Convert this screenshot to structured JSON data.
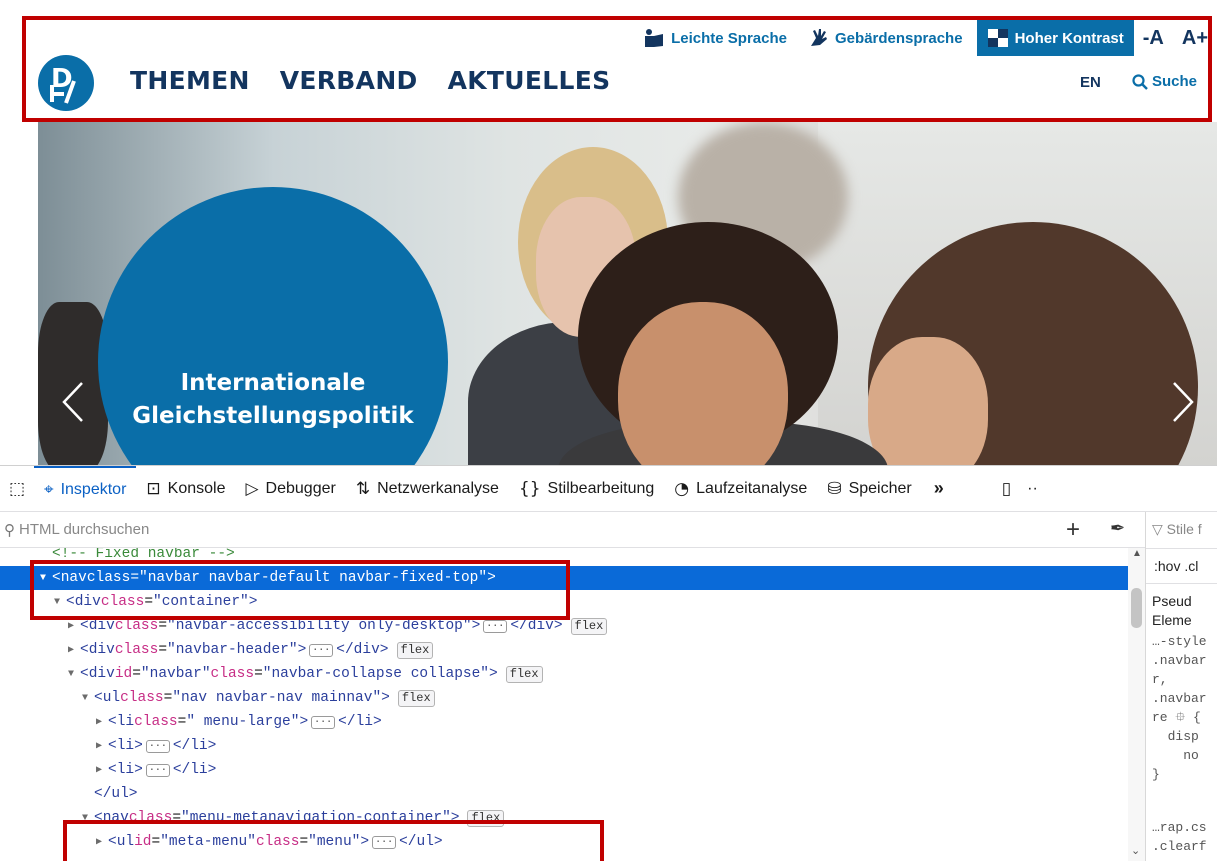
{
  "header": {
    "accessibility": {
      "easy_language": "Leichte Sprache",
      "sign_language": "Gebärdensprache",
      "high_contrast": "Hoher Kontrast",
      "font_smaller": "-A",
      "font_larger": "A+"
    },
    "nav": [
      "THEMEN",
      "VERBAND",
      "AKTUELLES"
    ],
    "language": "EN",
    "search_label": "Suche"
  },
  "hero": {
    "title_line1": "Internationale",
    "title_line2": "Gleichstellungspolitik"
  },
  "devtools": {
    "tabs": [
      "Inspektor",
      "Konsole",
      "Debugger",
      "Netzwerkanalyse",
      "Stilbearbeitung",
      "Laufzeitanalyse",
      "Speicher"
    ],
    "search_placeholder": "HTML durchsuchen",
    "tree": [
      {
        "comment": "<!-- Fixed navbar -->"
      },
      {
        "open": "nav",
        "attrs": [
          [
            "class",
            "navbar navbar-default navbar-fixed-top"
          ]
        ],
        "selected": true,
        "expanded": true
      },
      {
        "open": "div",
        "attrs": [
          [
            "class",
            "container"
          ]
        ],
        "expanded": true
      },
      {
        "open": "div",
        "attrs": [
          [
            "class",
            "navbar-accessibility only-desktop"
          ]
        ],
        "collapsed": true,
        "close": "div",
        "badge": "flex"
      },
      {
        "open": "div",
        "attrs": [
          [
            "class",
            "navbar-header"
          ]
        ],
        "collapsed": true,
        "close": "div",
        "badge": "flex"
      },
      {
        "open": "div",
        "attrs": [
          [
            "id",
            "navbar"
          ],
          [
            "class",
            "navbar-collapse collapse"
          ]
        ],
        "expanded": true,
        "badge": "flex"
      },
      {
        "open": "ul",
        "attrs": [
          [
            "class",
            "nav navbar-nav mainnav"
          ]
        ],
        "expanded": true,
        "badge": "flex"
      },
      {
        "open": "li",
        "attrs": [
          [
            "class",
            " menu-large"
          ]
        ],
        "collapsed": true,
        "close": "li"
      },
      {
        "open": "li",
        "attrs": [],
        "collapsed": true,
        "close": "li"
      },
      {
        "open": "li",
        "attrs": [],
        "collapsed": true,
        "close": "li"
      },
      {
        "closing": "ul"
      },
      {
        "open": "nav",
        "attrs": [
          [
            "class",
            "menu-metanavigation-container"
          ]
        ],
        "expanded": true,
        "badge": "flex"
      },
      {
        "open": "ul",
        "attrs": [
          [
            "id",
            "meta-menu"
          ],
          [
            "class",
            "menu"
          ]
        ],
        "collapsed": true,
        "close": "ul"
      }
    ],
    "styles_panel": {
      "filter_placeholder": "Stile f",
      "pseudo_toggles": ":hov  .cl",
      "pseudo_elements": [
        "Pseud",
        "Eleme"
      ],
      "css_block": "…-style\n.navbar\nr,\n.navbar\nre ⯐ {\n  disp\n    no\n}",
      "css_block2": "…rap.cs\n.clearf"
    }
  },
  "colors": {
    "brand_blue": "#0a6ea8",
    "nav_dark": "#13355f",
    "highlight_red": "#c00000",
    "selection_blue": "#0a6ad8"
  }
}
